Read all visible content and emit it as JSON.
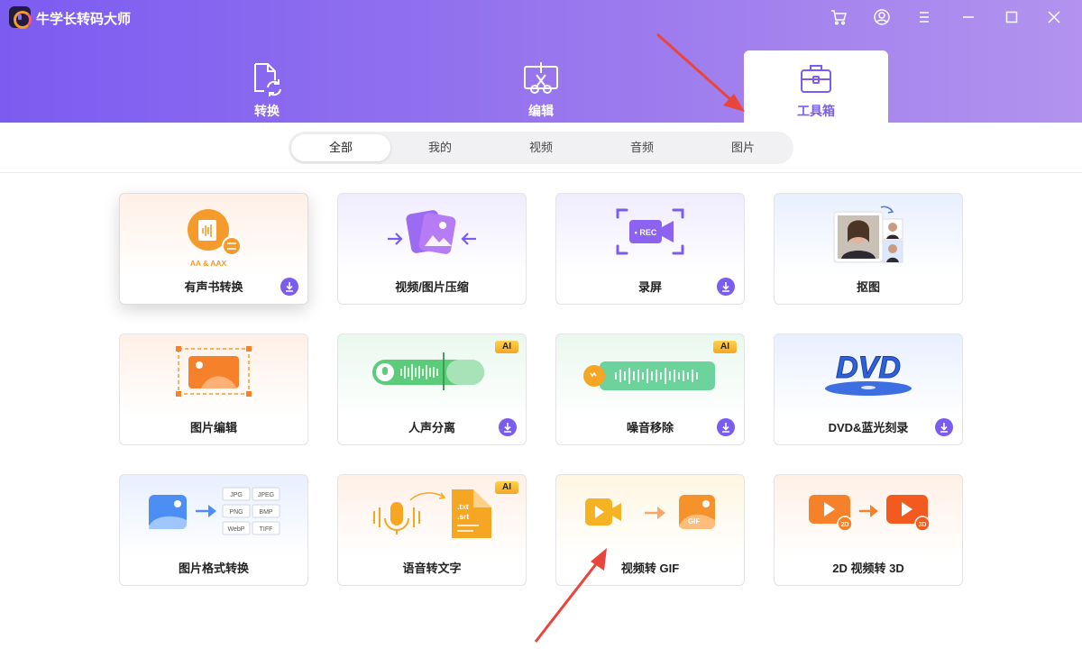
{
  "app": {
    "title": "牛学长转码大师"
  },
  "window_buttons": [
    "cart-icon",
    "user-icon",
    "menu-icon",
    "minimize-icon",
    "maximize-icon",
    "close-icon"
  ],
  "main_tabs": [
    {
      "label": "转换",
      "icon": "convert-icon"
    },
    {
      "label": "编辑",
      "icon": "edit-icon"
    },
    {
      "label": "工具箱",
      "icon": "toolbox-icon",
      "active": true
    }
  ],
  "sub_tabs": [
    {
      "label": "全部",
      "active": true
    },
    {
      "label": "我的"
    },
    {
      "label": "视频"
    },
    {
      "label": "音频"
    },
    {
      "label": "图片"
    }
  ],
  "tools": [
    {
      "label": "有声书转换",
      "art_text": "AA & AAX",
      "download": true
    },
    {
      "label": "视频/图片压缩"
    },
    {
      "label": "录屏",
      "art_text": "• REC",
      "download": true
    },
    {
      "label": "抠图"
    },
    {
      "label": "图片编辑"
    },
    {
      "label": "人声分离",
      "badge": "AI",
      "download": true
    },
    {
      "label": "噪音移除",
      "badge": "AI",
      "download": true
    },
    {
      "label": "DVD&蓝光刻录",
      "art_text": "DVD",
      "download": true
    },
    {
      "label": "图片格式转换",
      "formats": [
        "JPG",
        "JPEG",
        "PNG",
        "BMP",
        "WebP",
        "TIFF"
      ]
    },
    {
      "label": "语音转文字",
      "badge": "AI",
      "art_text_1": ".txt",
      "art_text_2": ".srt"
    },
    {
      "label": "视频转 GIF",
      "art_text": "GIF"
    },
    {
      "label": "2D 视频转 3D",
      "art_text_1": "2D",
      "art_text_2": "3D"
    }
  ],
  "colors": {
    "accent": "#7b5cf0",
    "annotation_arrow": "#e8453c",
    "ai_badge": "#f5b623"
  }
}
